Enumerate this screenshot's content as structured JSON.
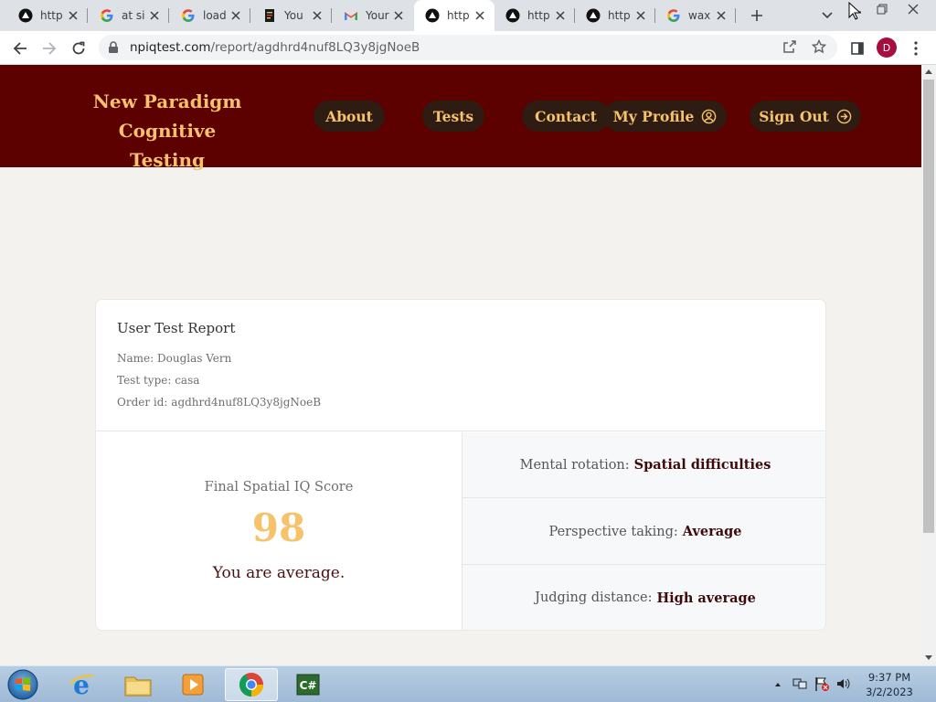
{
  "browser": {
    "tabs": [
      {
        "title": "http",
        "favicon": "vercel-icon"
      },
      {
        "title": "at si",
        "favicon": "google-icon"
      },
      {
        "title": "load",
        "favicon": "google-icon"
      },
      {
        "title": "You",
        "favicon": "doc-icon"
      },
      {
        "title": "Your",
        "favicon": "gmail-icon"
      },
      {
        "title": "http",
        "favicon": "vercel-icon",
        "active": true
      },
      {
        "title": "http",
        "favicon": "vercel-icon"
      },
      {
        "title": "http",
        "favicon": "vercel-icon"
      },
      {
        "title": "wax",
        "favicon": "google-icon"
      }
    ],
    "url_domain": "npiqtest.com",
    "url_path": "/report/agdhrd4nuf8LQ3y8jgNoeB",
    "profile_initial": "D"
  },
  "site": {
    "brand_line1": "New Paradigm",
    "brand_line2": "Cognitive Testing",
    "nav": {
      "about": "About",
      "tests": "Tests",
      "contact": "Contact",
      "my_profile": "My Profile",
      "sign_out": "Sign Out"
    },
    "colors": {
      "header_bg": "#5c0000",
      "accent": "#f6c36c",
      "nav_pill": "#2e1b12"
    }
  },
  "report": {
    "title": "User Test Report",
    "name": "Name: Douglas Vern",
    "test_type": "Test type: casa",
    "order_id": "Order id: agdhrd4nuf8LQ3y8jgNoeB",
    "score_label": "Final Spatial IQ Score",
    "score_value": "98",
    "score_message": "You are average.",
    "results": [
      {
        "label": "Mental rotation:",
        "value": "Spatial difficulties"
      },
      {
        "label": "Perspective taking:",
        "value": "Average"
      },
      {
        "label": "Judging distance:",
        "value": "High average"
      }
    ]
  },
  "taskbar": {
    "time": "9:37 PM",
    "date": "3/2/2023"
  }
}
